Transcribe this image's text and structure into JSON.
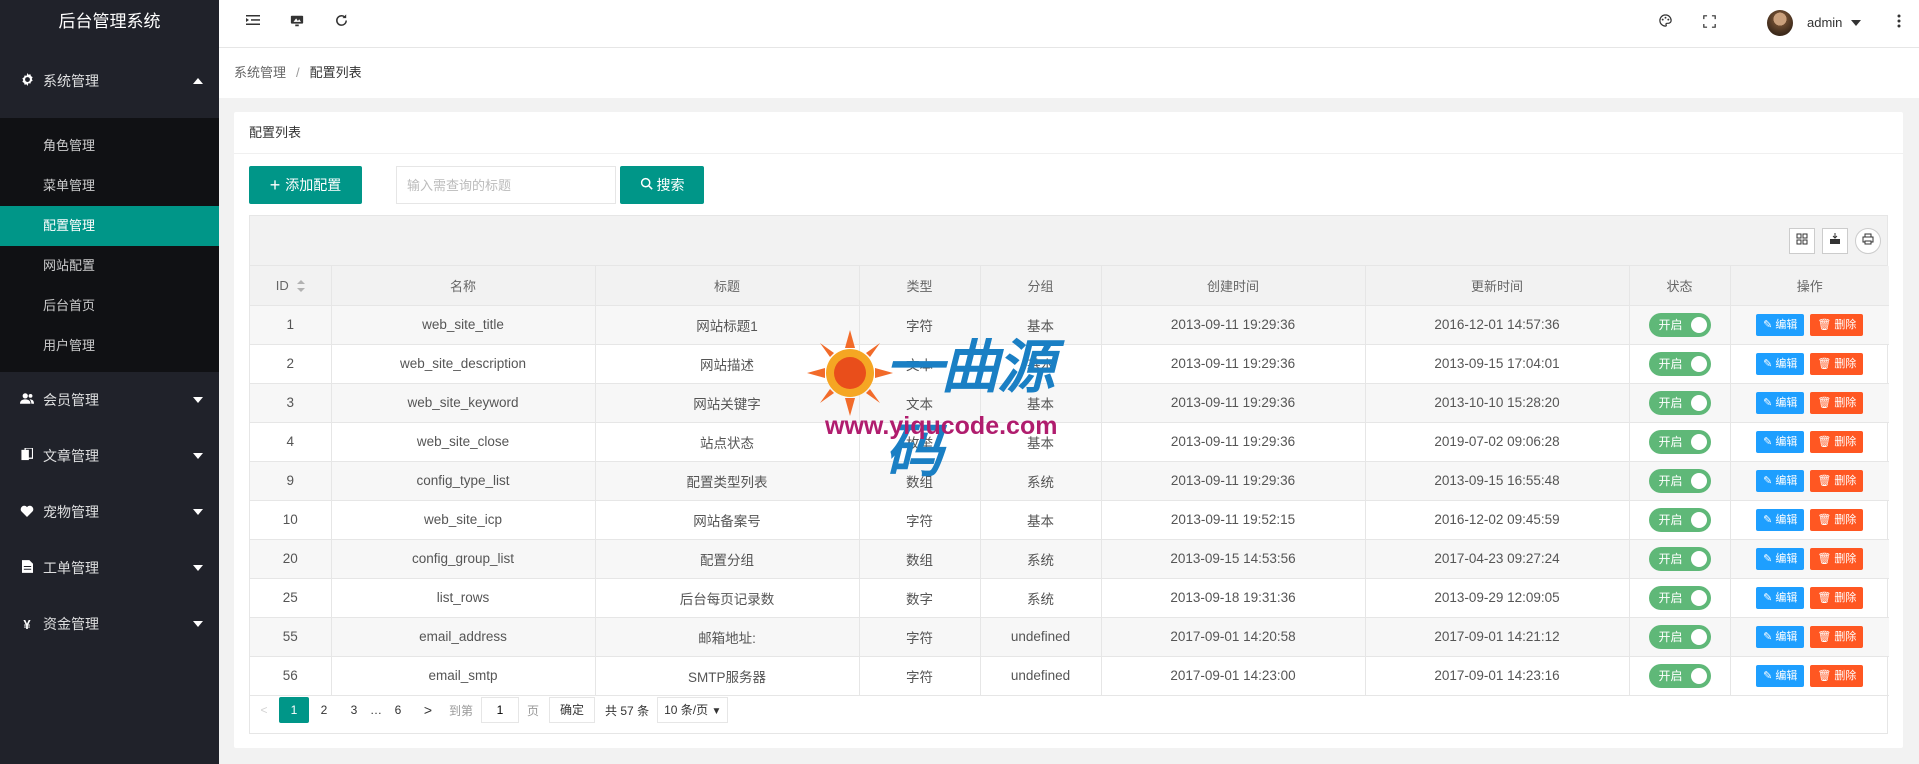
{
  "sidebar": {
    "app_title": "后台管理系统",
    "system_group": "系统管理",
    "sub_items": [
      "角色管理",
      "菜单管理",
      "配置管理",
      "网站配置",
      "后台首页",
      "用户管理"
    ],
    "active_index": 2,
    "groups": [
      {
        "label": "会员管理",
        "icon": "users-icon"
      },
      {
        "label": "文章管理",
        "icon": "documents-icon"
      },
      {
        "label": "宠物管理",
        "icon": "heart-icon"
      },
      {
        "label": "工单管理",
        "icon": "file-icon"
      },
      {
        "label": "资金管理",
        "icon": "yen-icon"
      }
    ]
  },
  "header": {
    "user": "admin"
  },
  "breadcrumb": {
    "parent": "系统管理",
    "current": "配置列表"
  },
  "panel": {
    "title": "配置列表",
    "add_label": "添加配置",
    "search_placeholder": "输入需查询的标题",
    "search_label": "搜索"
  },
  "table": {
    "headers": [
      "ID",
      "名称",
      "标题",
      "类型",
      "分组",
      "创建时间",
      "更新时间",
      "状态",
      "操作"
    ],
    "switch_label": "开启",
    "edit_label": "编辑",
    "delete_label": "删除",
    "rows": [
      [
        "1",
        "web_site_title",
        "网站标题1",
        "字符",
        "基本",
        "2013-09-11 19:29:36",
        "2016-12-01 14:57:36"
      ],
      [
        "2",
        "web_site_description",
        "网站描述",
        "文本",
        "基本",
        "2013-09-11 19:29:36",
        "2013-09-15 17:04:01"
      ],
      [
        "3",
        "web_site_keyword",
        "网站关键字",
        "文本",
        "基本",
        "2013-09-11 19:29:36",
        "2013-10-10 15:28:20"
      ],
      [
        "4",
        "web_site_close",
        "站点状态",
        "枚举",
        "基本",
        "2013-09-11 19:29:36",
        "2019-07-02 09:06:28"
      ],
      [
        "9",
        "config_type_list",
        "配置类型列表",
        "数组",
        "系统",
        "2013-09-11 19:29:36",
        "2013-09-15 16:55:48"
      ],
      [
        "10",
        "web_site_icp",
        "网站备案号",
        "字符",
        "基本",
        "2013-09-11 19:52:15",
        "2016-12-02 09:45:59"
      ],
      [
        "20",
        "config_group_list",
        "配置分组",
        "数组",
        "系统",
        "2013-09-15 14:53:56",
        "2017-04-23 09:27:24"
      ],
      [
        "25",
        "list_rows",
        "后台每页记录数",
        "数字",
        "系统",
        "2013-09-18 19:31:36",
        "2013-09-29 12:09:05"
      ],
      [
        "55",
        "email_address",
        "邮箱地址:",
        "字符",
        "undefined",
        "2017-09-01 14:20:58",
        "2017-09-01 14:21:12"
      ],
      [
        "56",
        "email_smtp",
        "SMTP服务器",
        "字符",
        "undefined",
        "2017-09-01 14:23:00",
        "2017-09-01 14:23:16"
      ]
    ]
  },
  "pager": {
    "pages": [
      "1",
      "2",
      "3",
      "…",
      "6"
    ],
    "goto": "到第",
    "goto_value": "1",
    "page_unit": "页",
    "confirm": "确定",
    "total": "共 57 条",
    "limit": "10 条/页"
  },
  "watermark": {
    "title": "一曲源码",
    "url": "www.yiqucode.com"
  },
  "colors": {
    "accent": "#009688",
    "sidebar": "#20222a",
    "edit": "#1e9fff",
    "delete": "#ff5722",
    "switch_on": "#5fb878"
  }
}
